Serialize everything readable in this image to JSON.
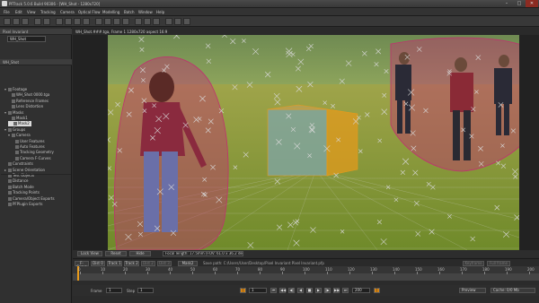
{
  "window": {
    "title": "PFTrack 5.0.6 Build 90306 - [WH_Shot - 1280x720]",
    "min_glyph": "–",
    "max_glyph": "□",
    "close_glyph": "✕"
  },
  "menu": [
    "File",
    "Edit",
    "View",
    "Tracking",
    "Camera",
    "Optical Flow",
    "Modelling",
    "Batch",
    "Window",
    "Help"
  ],
  "left_panel": {
    "header1": "Pixel Invariant",
    "shot_value": "WH_Shot",
    "header2": "WH_Shot",
    "tree": [
      {
        "indent": 1,
        "tri": "▾",
        "label": "Footage"
      },
      {
        "indent": 2,
        "tri": "",
        "label": "WH_Shot 0000.tga"
      },
      {
        "indent": 2,
        "tri": "",
        "label": "Reference Frames"
      },
      {
        "indent": 2,
        "tri": "",
        "label": "Lens Distortion"
      },
      {
        "indent": 1,
        "tri": "▾",
        "label": "Masks"
      },
      {
        "indent": 2,
        "tri": "",
        "label": "Mask1"
      },
      {
        "indent": 2,
        "tri": "",
        "label": "Mask2",
        "selected": true
      },
      {
        "indent": 1,
        "tri": "▾",
        "label": "Groups"
      },
      {
        "indent": 2,
        "tri": "▾",
        "label": "Camera"
      },
      {
        "indent": 3,
        "tri": "",
        "label": "User Features"
      },
      {
        "indent": 3,
        "tri": "",
        "label": "Auto Features"
      },
      {
        "indent": 3,
        "tri": "",
        "label": "Tracking Geometry"
      },
      {
        "indent": 3,
        "tri": "",
        "label": "Camera F-Curves"
      },
      {
        "indent": 1,
        "tri": "",
        "label": "Constraints"
      },
      {
        "indent": 1,
        "tri": "▸",
        "label": "Scene Orientation"
      },
      {
        "indent": 1,
        "tri": "",
        "label": "Test Objects"
      },
      {
        "indent": 1,
        "tri": "",
        "label": "Distance"
      },
      {
        "indent": 1,
        "tri": "",
        "label": "Batch Mode"
      },
      {
        "indent": 1,
        "tri": "",
        "label": "Tracking Points"
      },
      {
        "indent": 1,
        "tri": "",
        "label": "Camera/Object Exports"
      },
      {
        "indent": 1,
        "tri": "",
        "label": "PFPlugin Exports"
      }
    ]
  },
  "viewport": {
    "title": "WH_Shot.###.tga, Frame 1 1280x720 aspect 16:9",
    "buttons": [
      "Lock View",
      "Reset",
      "Hide"
    ],
    "focal_info": "Focal length: 17.5mm (FOV: 61.0 x 36.2 degrees)"
  },
  "curves": {
    "buttons": [
      "F-Curve",
      "Dist 0",
      "Track 1",
      "Track 2"
    ],
    "dim_buttons": [
      "Dist 2",
      "Dist 3"
    ],
    "mask_label": "Mask2",
    "path": "Save path: C:/Users/User/Desktop/Pixel Invariant Pixel Invariant.pfp",
    "right_buttons": [
      "Keyframe",
      "Full frame"
    ]
  },
  "timeline": {
    "ticks": [
      "0",
      "10",
      "20",
      "30",
      "40",
      "50",
      "60",
      "70",
      "80",
      "90",
      "100",
      "110",
      "120",
      "130",
      "140",
      "150",
      "160",
      "170",
      "180",
      "190",
      "200"
    ]
  },
  "transport": {
    "frame_label": "Frame",
    "frame_value": "1",
    "step_label": "Step",
    "step_value": "1",
    "current_frame": "1",
    "end_frame": "200",
    "glyphs": [
      "⏮",
      "◀◀",
      "◀|",
      "◀",
      "■",
      "▶",
      "|▶",
      "▶▶",
      "⏭"
    ],
    "render_mode": "Preview",
    "cache_info": "Cache: 0/0 Mb"
  },
  "colors": {
    "accent": "#e89a1a",
    "mask": "#c03070",
    "cube": "#e89a1a",
    "marker": "#d8d8d8"
  }
}
